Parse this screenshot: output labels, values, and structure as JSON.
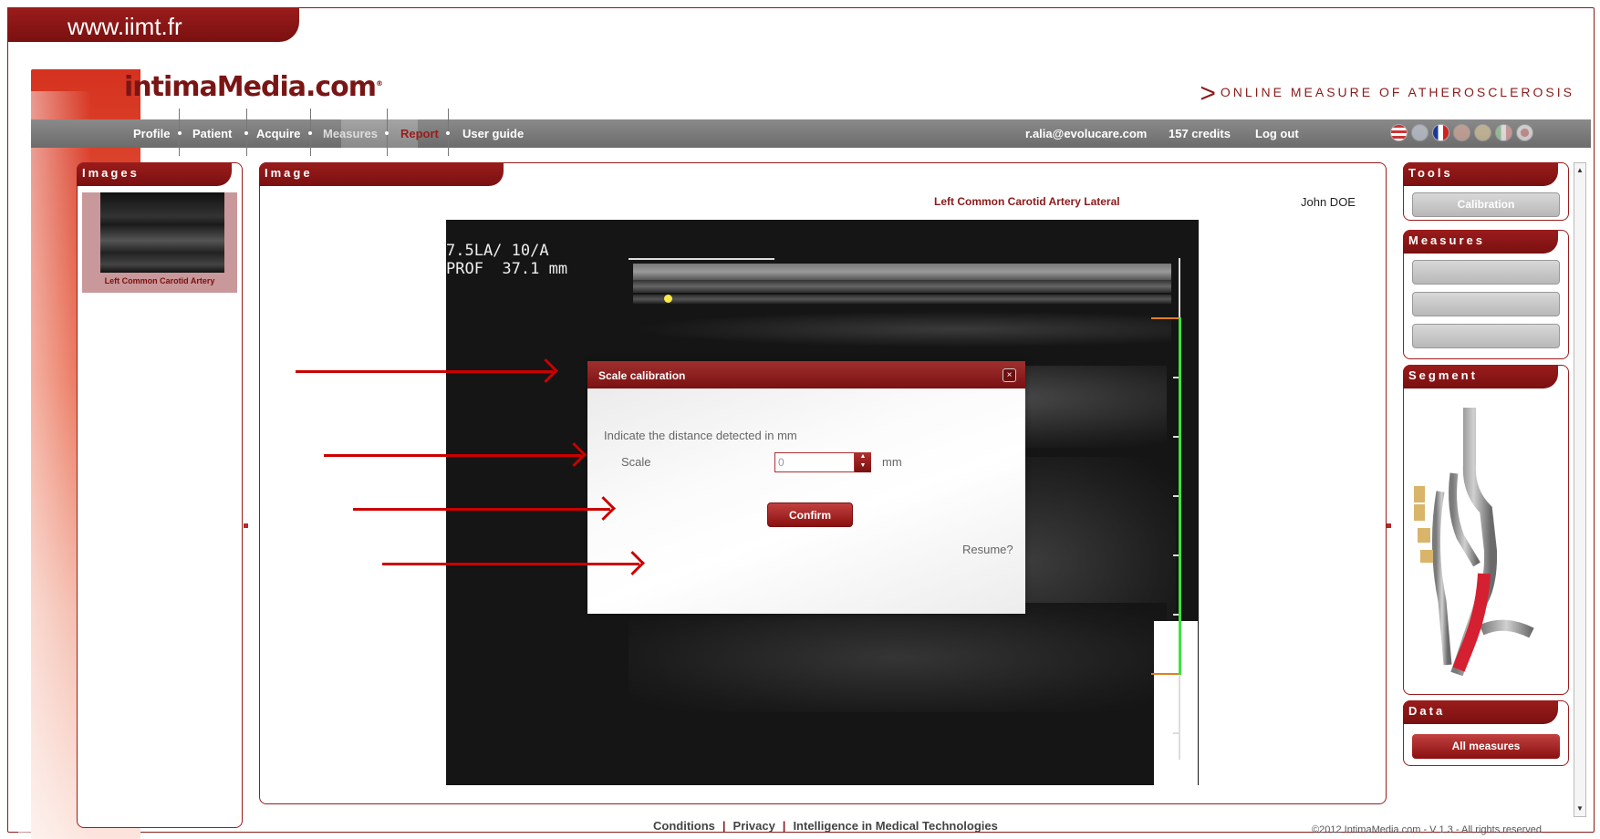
{
  "site_url": "www.iimt.fr",
  "header": {
    "logo": "intimaMedia.com",
    "tagline": "Online measure of Atherosclerosis"
  },
  "nav": {
    "items": [
      "Profile",
      "Patient",
      "Acquire",
      "Measures",
      "Report",
      "User guide"
    ],
    "active": "Measures",
    "user_email": "r.alia@evolucare.com",
    "credits": "157 credits",
    "logout": "Log out",
    "language_flags": [
      "flag-us-icon",
      "flag-uk-icon",
      "flag-fr-icon",
      "flag-es-icon",
      "flag-de-icon",
      "flag-it-icon",
      "flag-jp-icon"
    ]
  },
  "images_panel": {
    "title": "Images",
    "thumbnail_label": "Left Common Carotid Artery"
  },
  "image_panel": {
    "title": "Image",
    "image_title": "Left Common Carotid Artery Lateral",
    "patient_name": "John DOE",
    "overlay_line1": "7.5LA/ 10/A",
    "overlay_line2": "PROF  37.1 mm"
  },
  "dialog": {
    "title": "Scale calibration",
    "close": "×",
    "instruction": "Indicate the distance detected in mm",
    "scale_label": "Scale",
    "scale_value": "0",
    "unit": "mm",
    "confirm": "Confirm",
    "resume": "Resume?"
  },
  "tools_panel": {
    "title": "Tools",
    "calibration": "Calibration"
  },
  "measures_panel": {
    "title": "Measures",
    "buttons": [
      "",
      "",
      ""
    ]
  },
  "segment_panel": {
    "title": "Segment"
  },
  "data_panel": {
    "title": "Data",
    "all_measures": "All measures"
  },
  "footer": {
    "links": [
      "Conditions",
      "Privacy",
      "Intelligence in Medical Technologies"
    ],
    "copyright": "©2012 IntimaMedia.com - V 1.3 - All rights reserved"
  },
  "colors": {
    "brand": "#8b1a1a",
    "nav_bg": "#7a7a7a",
    "calibration_line": "#40e040"
  }
}
